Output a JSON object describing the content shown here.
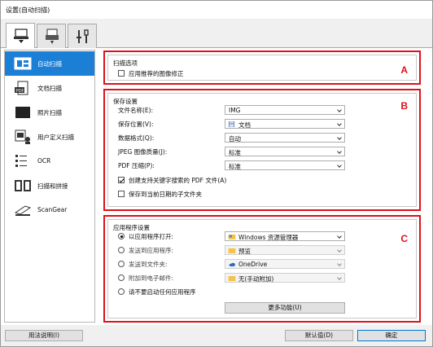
{
  "window": {
    "title": "设置(自动扫描)"
  },
  "top_tabs": [
    {
      "name": "scan-from-computer"
    },
    {
      "name": "scan-from-panel"
    },
    {
      "name": "general-settings"
    }
  ],
  "sidebar": {
    "items": [
      {
        "label": "自动扫描",
        "active": true
      },
      {
        "label": "文档扫描"
      },
      {
        "label": "照片扫描"
      },
      {
        "label": "用户定义扫描"
      },
      {
        "label": "OCR"
      },
      {
        "label": "扫描和拼接"
      },
      {
        "label": "ScanGear"
      }
    ]
  },
  "scan_options": {
    "group_title": "扫描选项",
    "marker": "A",
    "apply_correction": "应用推荐的图像修正",
    "apply_correction_checked": false
  },
  "save_settings": {
    "group_title": "保存设置",
    "marker": "B",
    "file_name": {
      "label": "文件名称(E):",
      "value": "IMG"
    },
    "save_in": {
      "label": "保存位置(V):",
      "value": "文档"
    },
    "data_format": {
      "label": "数据格式(Q):",
      "value": "自动"
    },
    "jpeg_quality": {
      "label": "JPEG 图像质量(J):",
      "value": "标准"
    },
    "pdf_compression": {
      "label": "PDF 压缩(P):",
      "value": "标准"
    },
    "keyword_pdf": {
      "label": "创建支持关键字搜索的 PDF 文件(A)",
      "checked": true
    },
    "save_subfolder": {
      "label": "保存到当前日期的子文件夹",
      "checked": false
    }
  },
  "app_settings": {
    "group_title": "应用程序设置",
    "marker": "C",
    "open_with": {
      "label": "以应用程序打开:",
      "value": "Windows 资源管理器",
      "selected": true
    },
    "send_to_app": {
      "label": "发送到应用程序:",
      "value": "预览"
    },
    "send_to_folder": {
      "label": "发送到文件夹:",
      "value": "OneDrive"
    },
    "attach_email": {
      "label": "附加到电子邮件:",
      "value": "无(手动附加)"
    },
    "do_not_start": {
      "label": "请不要启动任何应用程序"
    },
    "more_functions": "更多功能(U)"
  },
  "footer": {
    "instructions": "用法说明(I)",
    "defaults": "默认值(D)",
    "ok": "确定"
  },
  "colors": {
    "accent": "#1b7fd6",
    "marker_red": "#e0101a"
  }
}
